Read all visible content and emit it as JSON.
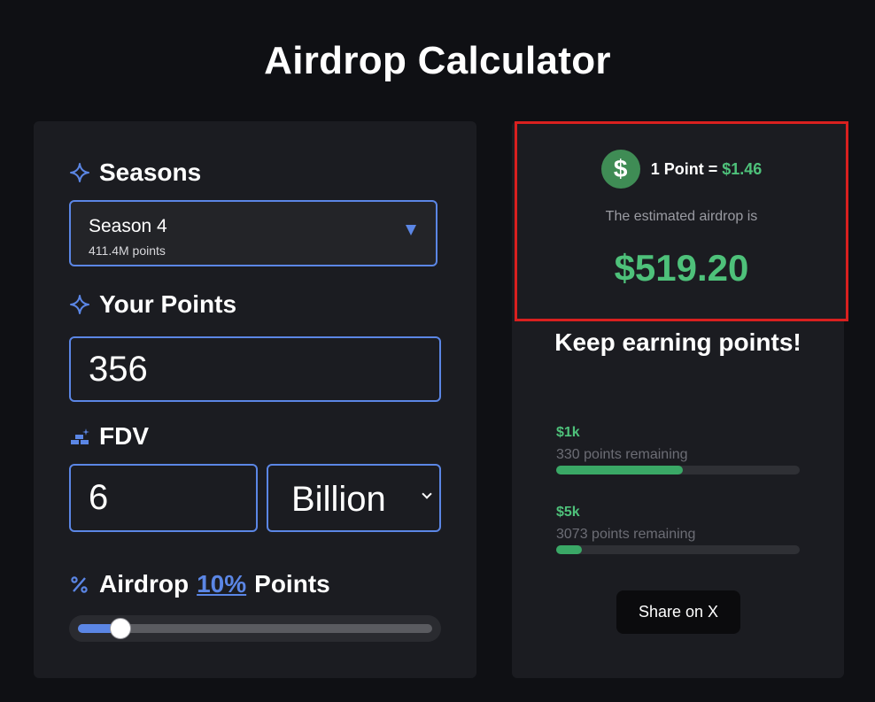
{
  "page_title": "Airdrop Calculator",
  "seasons": {
    "heading": "Seasons",
    "selected_name": "Season 4",
    "selected_points": "411.4M points"
  },
  "your_points": {
    "heading": "Your Points",
    "value": "356"
  },
  "fdv": {
    "heading": "FDV",
    "value": "6",
    "unit": "Billion"
  },
  "airdrop": {
    "label_prefix": "Airdrop",
    "percent_label": "10%",
    "label_suffix": "Points",
    "slider_fraction": 0.12
  },
  "estimate": {
    "rate_prefix": "1 Point = ",
    "rate_value": "$1.46",
    "icon_symbol": "$",
    "label": "The estimated airdrop is",
    "value": "$519.20"
  },
  "keep_earning": "Keep earning points!",
  "goals": [
    {
      "amount": "$1k",
      "remaining": "330 points remaining",
      "progress": 0.52
    },
    {
      "amount": "$5k",
      "remaining": "3073 points remaining",
      "progress": 0.104
    }
  ],
  "share_label": "Share on X",
  "colors": {
    "accent": "#5b86e5",
    "positive": "#4ec17a",
    "highlight_border": "#d9201f"
  },
  "icons": {
    "seasons": "sparkle-icon",
    "points": "sparkle-icon",
    "fdv": "bricks-icon",
    "airdrop": "percent-icon",
    "rate": "dollar-icon"
  }
}
